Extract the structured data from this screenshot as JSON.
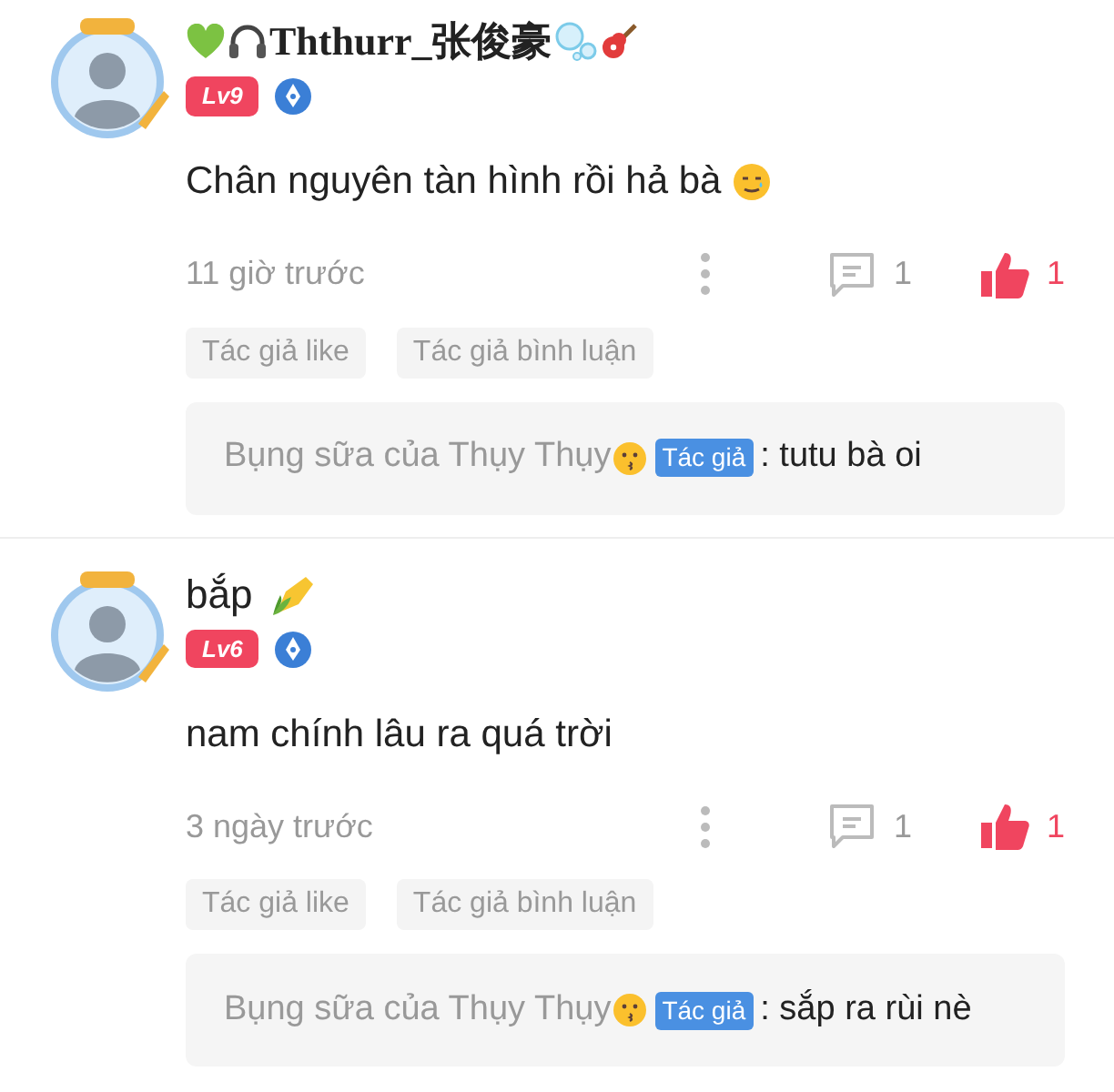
{
  "comments": [
    {
      "kind": "decorated",
      "username": "Ththurr_张俊豪",
      "level": "Lv9",
      "text": "Chân nguyên tàn hình rồi hả bà",
      "time": "11 giờ trước",
      "reply_count": "1",
      "like_count": "1",
      "liked": true,
      "tags": [
        "Tác giả like",
        "Tác giả bình luận"
      ],
      "reply": {
        "author": "Bụng sữa của Thụy Thụy",
        "badge": "Tác giả",
        "text": ": tutu bà oi"
      }
    },
    {
      "kind": "plain",
      "username": "bắp",
      "level": "Lv6",
      "text": "nam chính lâu ra quá trời",
      "time": "3 ngày trước",
      "reply_count": "1",
      "like_count": "1",
      "liked": true,
      "tags": [
        "Tác giả like",
        "Tác giả bình luận"
      ],
      "reply": {
        "author": "Bụng sữa của Thụy Thụy",
        "badge": "Tác giả",
        "text": ": sắp ra rùi nè"
      }
    }
  ]
}
